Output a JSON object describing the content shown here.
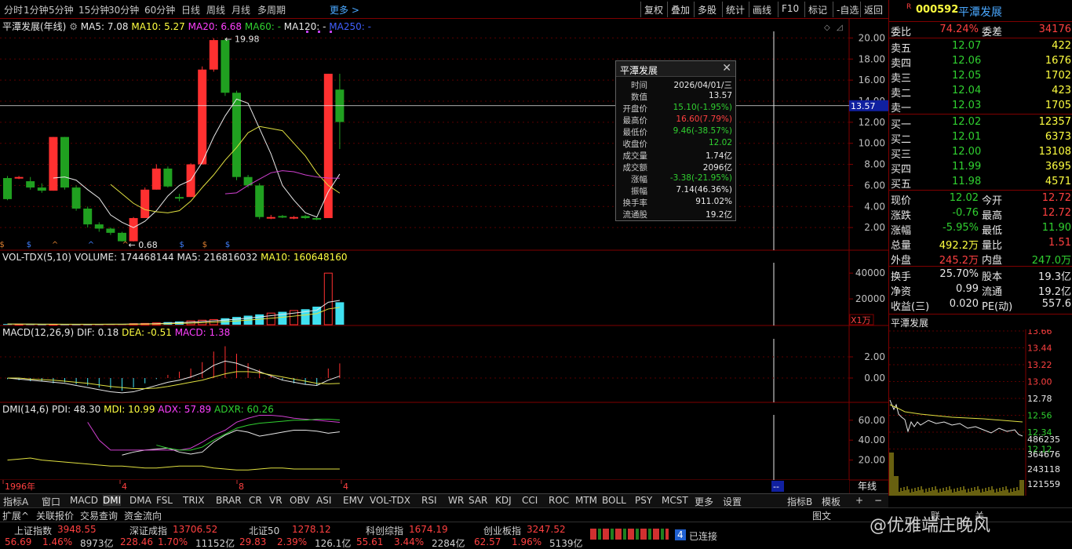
{
  "topbar": {
    "periods": [
      "分时",
      "1分钟",
      "5分钟",
      "15分钟",
      "30分钟",
      "60分钟",
      "日线",
      "周线",
      "月线",
      "多周期"
    ],
    "more": "更多 >",
    "tools": [
      "复权",
      "叠加",
      "多股",
      "统计",
      "画线",
      "F10",
      "标记",
      "-自选",
      "返回"
    ]
  },
  "kline_panel": {
    "title": "平潭发展(年线)",
    "ma5": "MA5: 7.08",
    "ma10": "MA10: 5.27",
    "ma20": "MA20: 6.68",
    "ma60": "MA60: -",
    "ma120": "MA120: -",
    "ma250": "MA250: -",
    "high_label": "19.98",
    "low_label": "0.68",
    "y_ticks": [
      "20.00",
      "18.00",
      "16.00",
      "14.00",
      "12.00",
      "10.00",
      "8.00",
      "6.00",
      "4.00",
      "2.00"
    ],
    "cursor_value": "13.57"
  },
  "vol_panel": {
    "title": "VOL-TDX(5,10)",
    "volume": "VOLUME: 174468144",
    "ma5": "MA5: 216816032",
    "ma10": "MA10: 160648160",
    "y_ticks": [
      "40000",
      "20000"
    ],
    "unit": "X1万"
  },
  "macd_panel": {
    "title": "MACD(12,26,9)",
    "dif": "DIF: 0.18",
    "dea": "DEA: -0.51",
    "macd": "MACD: 1.38",
    "y_ticks": [
      "2.00",
      "0.00"
    ]
  },
  "dmi_panel": {
    "title": "DMI(14,6)",
    "pdi": "PDI: 48.30",
    "mdi": "MDI: 10.99",
    "adx": "ADX: 57.89",
    "adxr": "ADXR: 60.26",
    "y_ticks": [
      "60.00",
      "40.00",
      "20.00"
    ]
  },
  "x_axis": {
    "labels": [
      "1996年",
      "4",
      "8",
      "4"
    ],
    "cursor": "--",
    "period": "年线"
  },
  "popup": {
    "title": "平潭发展",
    "rows": [
      {
        "k": "时间",
        "v": "2026/04/01/三",
        "c": "#e8e8e8"
      },
      {
        "k": "数值",
        "v": "13.57",
        "c": "#e8e8e8"
      },
      {
        "k": "开盘价",
        "v": "15.10(-1.95%)",
        "c": "#30d030"
      },
      {
        "k": "最高价",
        "v": "16.60(7.79%)",
        "c": "#ff4040"
      },
      {
        "k": "最低价",
        "v": "9.46(-38.57%)",
        "c": "#30d030"
      },
      {
        "k": "收盘价",
        "v": "12.02",
        "c": "#30d030"
      },
      {
        "k": "成交量",
        "v": "1.74亿",
        "c": "#e8e8e8"
      },
      {
        "k": "成交额",
        "v": "2096亿",
        "c": "#e8e8e8"
      },
      {
        "k": "涨幅",
        "v": "-3.38(-21.95%)",
        "c": "#30d030"
      },
      {
        "k": "振幅",
        "v": "7.14(46.36%)",
        "c": "#e8e8e8"
      },
      {
        "k": "换手率",
        "v": "911.02%",
        "c": "#e8e8e8"
      },
      {
        "k": "流通股",
        "v": "19.2亿",
        "c": "#e8e8e8"
      }
    ]
  },
  "quote": {
    "badge": "R",
    "code": "000592",
    "name": "平潭发展",
    "weibi_label": "委比",
    "weibi": "74.24%",
    "weicha_label": "委差",
    "weicha": "34176",
    "asks": [
      {
        "label": "卖五",
        "price": "12.07",
        "vol": "422"
      },
      {
        "label": "卖四",
        "price": "12.06",
        "vol": "1676"
      },
      {
        "label": "卖三",
        "price": "12.05",
        "vol": "1702"
      },
      {
        "label": "卖二",
        "price": "12.04",
        "vol": "423"
      },
      {
        "label": "卖一",
        "price": "12.03",
        "vol": "1705"
      }
    ],
    "bids": [
      {
        "label": "买一",
        "price": "12.02",
        "vol": "12357"
      },
      {
        "label": "买二",
        "price": "12.01",
        "vol": "6373"
      },
      {
        "label": "买三",
        "price": "12.00",
        "vol": "13108"
      },
      {
        "label": "买四",
        "price": "11.99",
        "vol": "3695"
      },
      {
        "label": "买五",
        "price": "11.98",
        "vol": "4571"
      }
    ],
    "stats": [
      {
        "l1": "现价",
        "v1": "12.02",
        "c1": "#30d030",
        "l2": "今开",
        "v2": "12.72",
        "c2": "#ff4040"
      },
      {
        "l1": "涨跌",
        "v1": "-0.76",
        "c1": "#30d030",
        "l2": "最高",
        "v2": "12.72",
        "c2": "#ff4040"
      },
      {
        "l1": "涨幅",
        "v1": "-5.95%",
        "c1": "#30d030",
        "l2": "最低",
        "v2": "11.90",
        "c2": "#30d030"
      },
      {
        "l1": "总量",
        "v1": "492.2万",
        "c1": "#ffff40",
        "l2": "量比",
        "v2": "1.51",
        "c2": "#ff4040"
      },
      {
        "l1": "外盘",
        "v1": "245.2万",
        "c1": "#ff4040",
        "l2": "内盘",
        "v2": "247.0万",
        "c2": "#30d030"
      }
    ],
    "stats2": [
      {
        "l1": "换手",
        "v1": "25.70%",
        "l2": "股本",
        "v2": "19.3亿"
      },
      {
        "l1": "净资",
        "v1": "0.99",
        "l2": "流通",
        "v2": "19.2亿"
      },
      {
        "l1": "收益(三)",
        "v1": "0.020",
        "l2": "PE(动)",
        "v2": "557.6"
      }
    ]
  },
  "mini_chart": {
    "title": "平潭发展",
    "price_ticks": [
      "13.66",
      "13.44",
      "13.22",
      "13.00",
      "12.78",
      "12.56",
      "12.34",
      "12.12"
    ],
    "vol_ticks": [
      "486235",
      "364676",
      "243118",
      "121559"
    ]
  },
  "indicator_tabs": [
    "指标A",
    "窗口",
    "MACD",
    "DMI",
    "DMA",
    "FSL",
    "TRIX",
    "BRAR",
    "CR",
    "VR",
    "OBV",
    "ASI",
    "EMV",
    "VOL-TDX",
    "RSI",
    "WR",
    "SAR",
    "KDJ",
    "CCI",
    "ROC",
    "MTM",
    "BOLL",
    "PSY",
    "MCST",
    "更多",
    "设置"
  ],
  "indicator_right": [
    "指标B",
    "模板",
    "+",
    "−"
  ],
  "bottom_links": [
    "扩展^",
    "关联报价",
    "交易查询",
    "资金流向"
  ],
  "bottom_right_links": [
    "图文",
    "联",
    "关"
  ],
  "indices": [
    {
      "name": "上证指数",
      "value": "3948.55",
      "chg": "56.69",
      "pct": "1.46%",
      "amt": "8973亿"
    },
    {
      "name": "深证成指",
      "value": "13706.52",
      "chg": "228.46",
      "pct": "1.70%",
      "amt": "11152亿"
    },
    {
      "name": "北证50",
      "value": "1278.12",
      "chg": "29.83",
      "pct": "2.39%",
      "amt": "126.1亿"
    },
    {
      "name": "科创综指",
      "value": "1674.19",
      "chg": "55.61",
      "pct": "3.44%",
      "amt": "2284亿"
    },
    {
      "name": "创业板指",
      "value": "3247.52",
      "chg": "62.57",
      "pct": "1.96%",
      "amt": "5139亿"
    }
  ],
  "status": {
    "count": "4",
    "text": "已连接"
  },
  "watermark": "@优雅端庄晚风",
  "chart_data": {
    "type": "candlestick",
    "title": "平潭发展(年线)",
    "candles": [
      {
        "o": 6.7,
        "h": 6.9,
        "c": 4.7,
        "l": 4.6
      },
      {
        "o": 6.8,
        "h": 6.9,
        "c": 6.8,
        "l": 6.6
      },
      {
        "o": 6.4,
        "h": 6.8,
        "c": 5.8,
        "l": 5.6
      },
      {
        "o": 5.8,
        "h": 6.2,
        "c": 5.5,
        "l": 5.3
      },
      {
        "o": 5.5,
        "h": 10.6,
        "c": 10.6,
        "l": 5.5
      },
      {
        "o": 10.6,
        "h": 10.6,
        "c": 5.8,
        "l": 5.6
      },
      {
        "o": 5.8,
        "h": 6.0,
        "c": 3.8,
        "l": 3.6
      },
      {
        "o": 3.8,
        "h": 4.0,
        "c": 2.3,
        "l": 2.0
      },
      {
        "o": 2.3,
        "h": 2.5,
        "c": 1.9,
        "l": 1.6
      },
      {
        "o": 1.9,
        "h": 2.0,
        "c": 1.5,
        "l": 1.3
      },
      {
        "o": 1.5,
        "h": 1.6,
        "c": 0.7,
        "l": 0.68
      },
      {
        "o": 0.7,
        "h": 3.0,
        "c": 2.9,
        "l": 0.68
      },
      {
        "o": 2.9,
        "h": 5.8,
        "c": 5.6,
        "l": 2.9
      },
      {
        "o": 5.6,
        "h": 8.0,
        "c": 7.6,
        "l": 5.6
      },
      {
        "o": 7.6,
        "h": 7.8,
        "c": 5.9,
        "l": 5.8
      },
      {
        "o": 4.9,
        "h": 5.2,
        "c": 4.8,
        "l": 4.5
      },
      {
        "o": 4.9,
        "h": 8.1,
        "c": 8.0,
        "l": 4.9
      },
      {
        "o": 8.0,
        "h": 17.3,
        "c": 17.0,
        "l": 8.0
      },
      {
        "o": 17.0,
        "h": 19.98,
        "c": 19.8,
        "l": 16.8
      },
      {
        "o": 19.8,
        "h": 19.98,
        "c": 14.8,
        "l": 14.5
      },
      {
        "o": 14.8,
        "h": 15.0,
        "c": 6.8,
        "l": 6.5
      },
      {
        "o": 6.8,
        "h": 7.0,
        "c": 6.0,
        "l": 5.8
      },
      {
        "o": 6.0,
        "h": 6.2,
        "c": 3.0,
        "l": 2.8
      },
      {
        "o": 3.0,
        "h": 3.2,
        "c": 3.0,
        "l": 2.8
      },
      {
        "o": 3.1,
        "h": 3.2,
        "c": 3.0,
        "l": 2.9
      },
      {
        "o": 3.0,
        "h": 3.1,
        "c": 3.0,
        "l": 2.8
      },
      {
        "o": 3.1,
        "h": 3.2,
        "c": 2.9,
        "l": 2.8
      },
      {
        "o": 2.9,
        "h": 3.0,
        "c": 2.8,
        "l": 2.7
      },
      {
        "o": 2.9,
        "h": 16.6,
        "c": 16.6,
        "l": 2.9
      },
      {
        "o": 15.1,
        "h": 16.6,
        "c": 12.02,
        "l": 9.46
      }
    ],
    "ma5": [
      null,
      null,
      null,
      null,
      6.7,
      6.8,
      6.5,
      5.6,
      4.8,
      3.2,
      2.5,
      2.0,
      2.6,
      3.6,
      5.0,
      6.0,
      6.5,
      8.2,
      10.6,
      12.6,
      14.2,
      13.8,
      11.4,
      9.0,
      6.0,
      4.6,
      3.4,
      3.0,
      5.4,
      7.08
    ],
    "ma10": [
      null,
      null,
      null,
      null,
      null,
      null,
      null,
      null,
      null,
      6.1,
      5.2,
      4.3,
      3.7,
      3.5,
      3.4,
      3.6,
      4.5,
      5.8,
      7.0,
      8.4,
      9.6,
      11.0,
      11.6,
      11.4,
      11.2,
      10.0,
      8.8,
      7.2,
      6.0,
      5.27
    ],
    "ma20": [
      null,
      null,
      null,
      null,
      null,
      null,
      null,
      null,
      null,
      null,
      null,
      null,
      null,
      null,
      null,
      null,
      null,
      null,
      null,
      5.2,
      5.3,
      6.0,
      6.6,
      7.2,
      7.4,
      7.3,
      7.0,
      6.8,
      6.7,
      6.68
    ],
    "ylim": [
      0,
      21
    ],
    "volume": [
      0.5,
      0.4,
      0.4,
      0.3,
      0.3,
      0.3,
      0.3,
      0.3,
      0.4,
      0.5,
      0.5,
      0.8,
      1.0,
      1.4,
      2.0,
      2.5,
      3.0,
      3.5,
      4.0,
      5.0,
      6.0,
      7.0,
      8.0,
      9.0,
      10.0,
      11.0,
      12.0,
      14.0,
      40.0,
      17.4
    ],
    "vol_unit": "万 x1000",
    "xlabels": [
      "1996年",
      "4",
      "8",
      "4"
    ]
  }
}
